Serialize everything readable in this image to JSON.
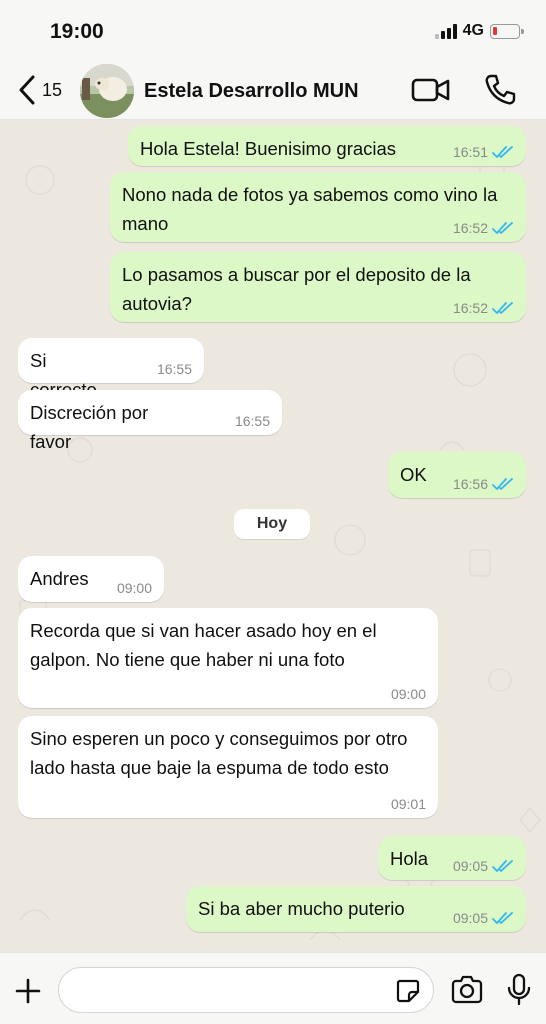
{
  "status_bar": {
    "time": "19:00",
    "network": "4G",
    "battery_level": 0.15,
    "battery_color": "#e53935"
  },
  "header": {
    "back_count": "15",
    "contact_name": "Estela Desarrollo MUN"
  },
  "colors": {
    "outgoing_bubble": "#dcf8c6",
    "incoming_bubble": "#ffffff",
    "read_ticks": "#34b7f1"
  },
  "messages": [
    {
      "dir": "out",
      "text": "Hola Estela! Buenisimo gracias",
      "time": "16:51",
      "read": true
    },
    {
      "dir": "out",
      "text": "Nono nada de fotos ya sabemos como vino la mano",
      "time": "16:52",
      "read": true
    },
    {
      "dir": "out",
      "text": "Lo pasamos a buscar por el deposito de la autovia?",
      "time": "16:52",
      "read": true
    },
    {
      "dir": "in",
      "text": "Si correcto.",
      "time": "16:55"
    },
    {
      "dir": "in",
      "text": "Discreción por favor",
      "time": "16:55"
    },
    {
      "dir": "out",
      "text": "OK",
      "time": "16:56",
      "read": true
    },
    {
      "dir": "in",
      "text": "Andres",
      "time": "09:00"
    },
    {
      "dir": "in",
      "text": "Recorda que si van hacer asado hoy en el galpon. No tiene que haber ni una foto",
      "time": "09:00"
    },
    {
      "dir": "in",
      "text": "Sino esperen un poco y conseguimos por otro lado hasta que baje la espuma de todo esto",
      "time": "09:01"
    },
    {
      "dir": "out",
      "text": "Hola",
      "time": "09:05",
      "read": true
    },
    {
      "dir": "out",
      "text": "Si ba aber mucho puterio",
      "time": "09:05",
      "read": true
    }
  ],
  "day_separator": "Hoy",
  "input": {
    "placeholder": ""
  }
}
